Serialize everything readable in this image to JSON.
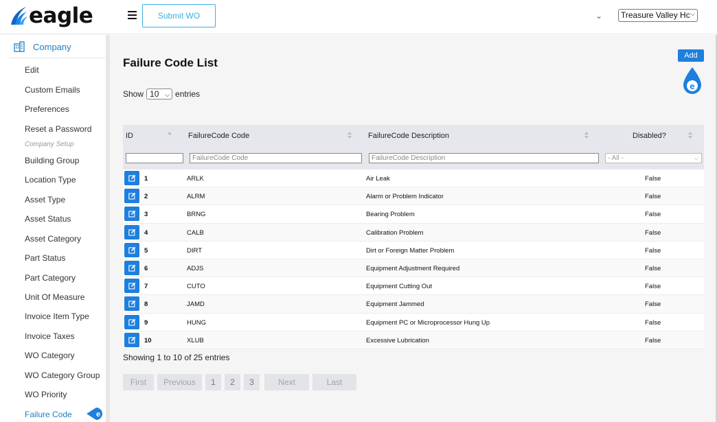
{
  "header": {
    "logo_text": "eagle",
    "submit_label": "Submit WO",
    "site_select": "Treasure Valley Hc"
  },
  "sidebar": {
    "company_label": "Company",
    "items_top": [
      "Edit",
      "Custom Emails",
      "Preferences",
      "Reset a Password"
    ],
    "section_label": "Company Setup",
    "items_setup": [
      "Building Group",
      "Location Type",
      "Asset Type",
      "Asset Status",
      "Asset Category",
      "Part Status",
      "Part Category",
      "Unit Of Measure",
      "Invoice Item Type",
      "Invoice Taxes",
      "WO Category",
      "WO Category Group",
      "WO Priority",
      "Failure Code"
    ],
    "active_item": "Failure Code"
  },
  "main": {
    "title": "Failure Code List",
    "add_label": "Add",
    "show_label": "Show",
    "entries_label": "entries",
    "page_length": "10",
    "columns": [
      "ID",
      "FailureCode Code",
      "FailureCode Description",
      "Disabled?"
    ],
    "filters": {
      "code_placeholder": "FailureCode Code",
      "desc_placeholder": "FailureCode Description",
      "disabled_value": "- All -"
    },
    "rows": [
      {
        "id": "1",
        "code": "ARLK",
        "desc": "Air Leak",
        "disabled": "False"
      },
      {
        "id": "2",
        "code": "ALRM",
        "desc": "Alarm or Problem Indicator",
        "disabled": "False"
      },
      {
        "id": "3",
        "code": "BRNG",
        "desc": "Bearing Problem",
        "disabled": "False"
      },
      {
        "id": "4",
        "code": "CALB",
        "desc": "Calibration Problem",
        "disabled": "False"
      },
      {
        "id": "5",
        "code": "DIRT",
        "desc": "Dirt or Foreign Matter Problem",
        "disabled": "False"
      },
      {
        "id": "6",
        "code": "ADJS",
        "desc": "Equipment Adjustment Required",
        "disabled": "False"
      },
      {
        "id": "7",
        "code": "CUTO",
        "desc": "Equipment Cutting Out",
        "disabled": "False"
      },
      {
        "id": "8",
        "code": "JAMD",
        "desc": "Equipment Jammed",
        "disabled": "False"
      },
      {
        "id": "9",
        "code": "HUNG",
        "desc": "Equipment PC or Microprocessor Hung Up",
        "disabled": "False"
      },
      {
        "id": "10",
        "code": "XLUB",
        "desc": "Excessive Lubrication",
        "disabled": "False"
      }
    ],
    "info": "Showing 1 to 10 of 25 entries",
    "pager": {
      "first": "First",
      "previous": "Previous",
      "pages": [
        "1",
        "2",
        "3"
      ],
      "next": "Next",
      "last": "Last"
    }
  },
  "colors": {
    "accent": "#1e7fde",
    "link": "#1c7fc4",
    "submit_outline": "#3bb0e0"
  }
}
